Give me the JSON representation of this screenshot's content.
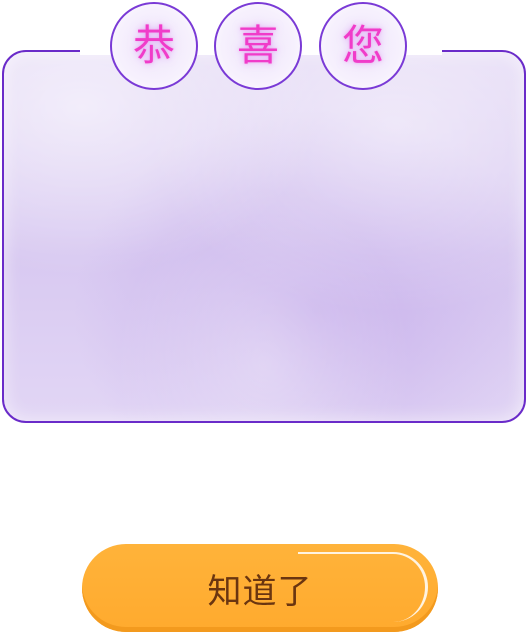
{
  "dialog": {
    "title_chars": [
      "恭",
      "喜",
      "您"
    ],
    "body_text": "",
    "confirm_label": "知道了"
  },
  "colors": {
    "card_border": "#6a2bc9",
    "card_fill": "#ddd0f3",
    "title_text": "#f03cc9",
    "button_fill": "#ffaa2e",
    "button_text": "#6a3510"
  }
}
